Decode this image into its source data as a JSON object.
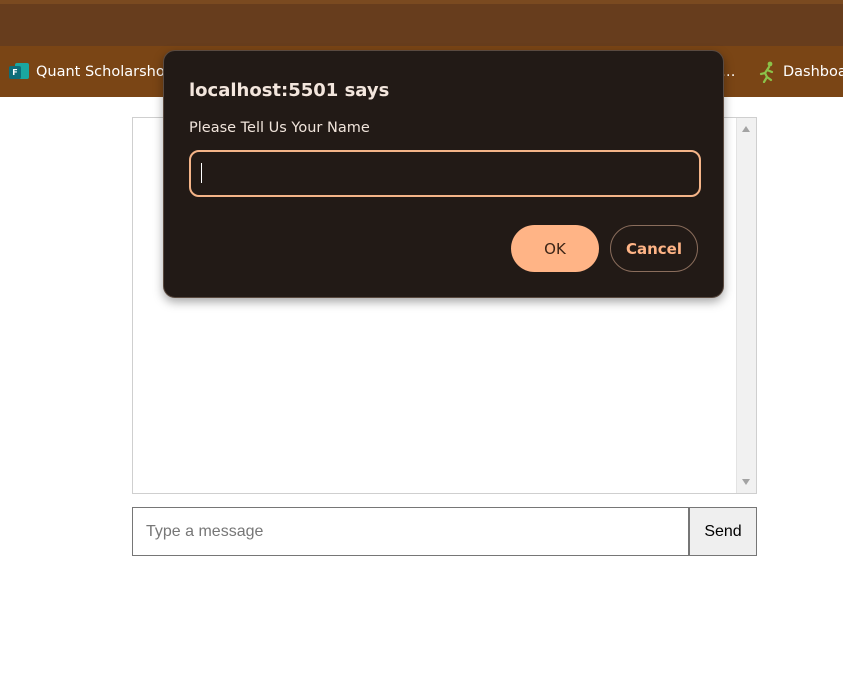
{
  "bookmarks_bar": {
    "items": [
      {
        "label": "Quant Scholarshop",
        "icon": "forms-icon"
      },
      {
        "label": "…",
        "icon": ""
      },
      {
        "label": "Dashboa",
        "icon": "runner-icon"
      }
    ]
  },
  "chat": {
    "input_placeholder": "Type a message",
    "input_value": "",
    "send_label": "Send"
  },
  "dialog": {
    "title": "localhost:5501 says",
    "message": "Please Tell Us Your Name",
    "input_value": "",
    "ok_label": "OK",
    "cancel_label": "Cancel"
  },
  "colors": {
    "chrome": "#673d1d",
    "bookmarks_bar": "#7a4515",
    "dialog_bg": "#221a16",
    "accent": "#ffb486"
  }
}
